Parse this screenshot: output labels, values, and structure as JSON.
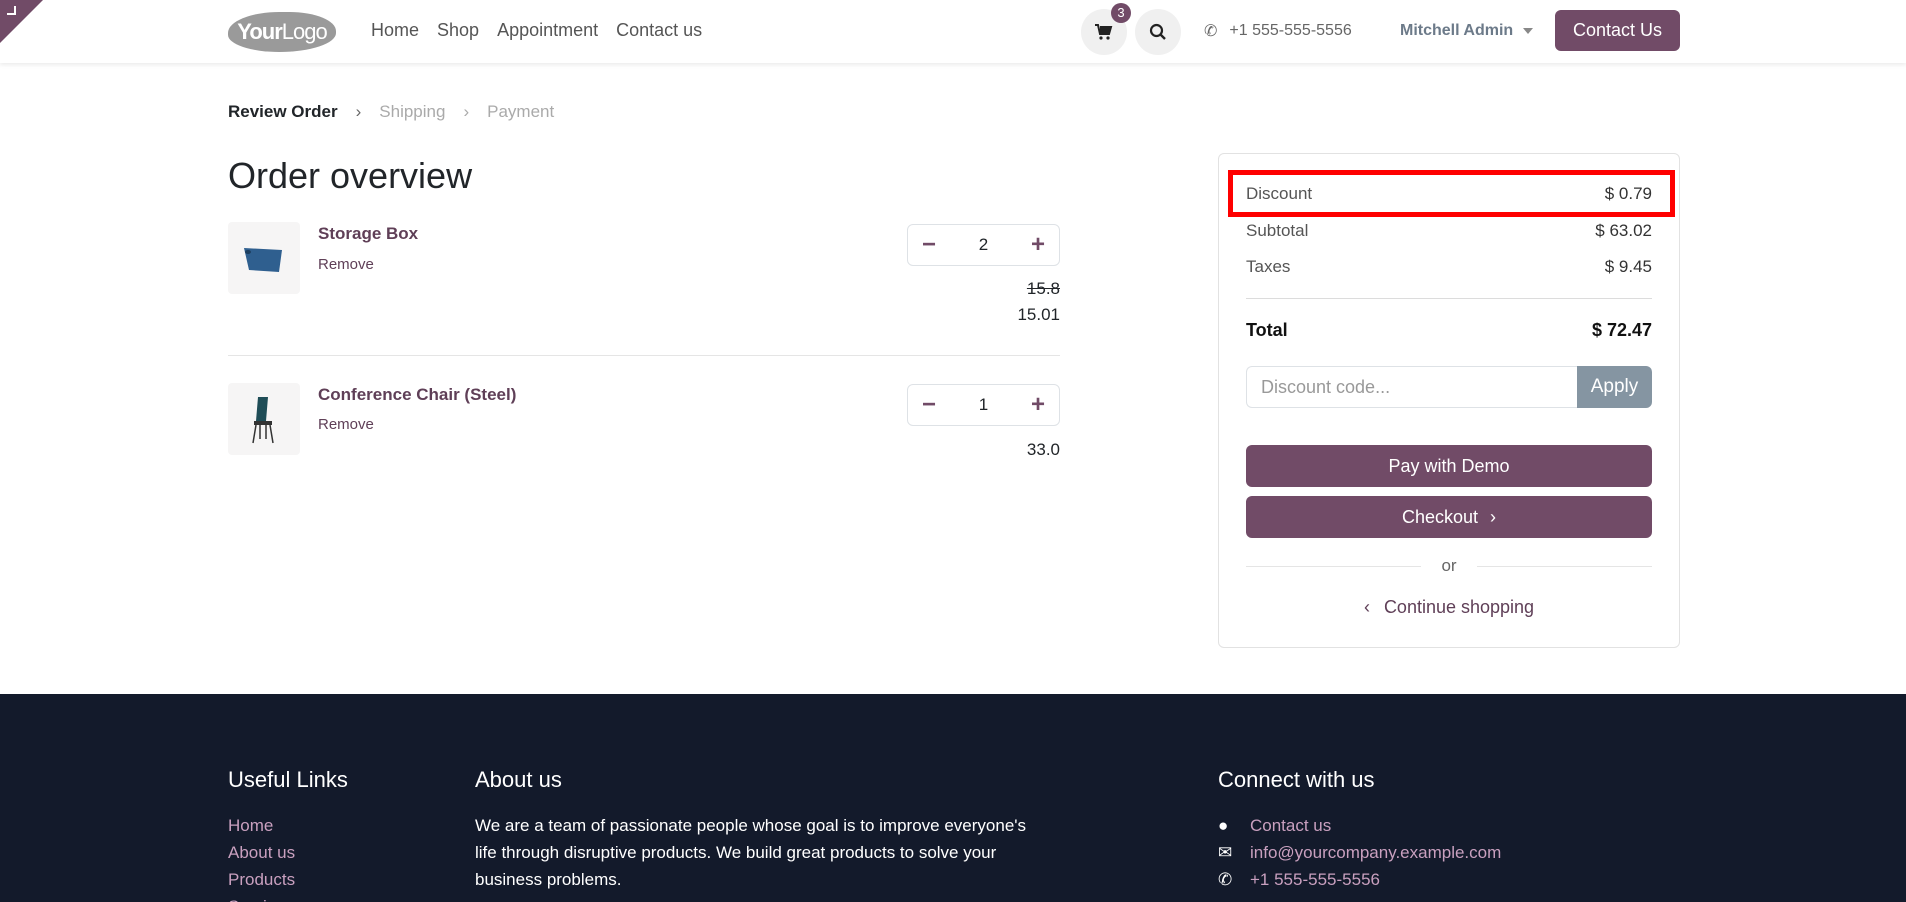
{
  "header": {
    "logo": "YourLogo",
    "logo_parts": [
      "Your",
      "Logo"
    ],
    "nav": [
      "Home",
      "Shop",
      "Appointment",
      "Contact us"
    ],
    "cart_count": "3",
    "phone": "+1 555-555-5556",
    "user": "Mitchell Admin",
    "contact_button": "Contact Us"
  },
  "breadcrumb": [
    "Review Order",
    "Shipping",
    "Payment"
  ],
  "title": "Order overview",
  "items": [
    {
      "name": "Storage Box",
      "remove": "Remove",
      "qty": "2",
      "old_price": "15.8",
      "price": "15.01"
    },
    {
      "name": "Conference Chair (Steel)",
      "remove": "Remove",
      "qty": "1",
      "price": "33.0"
    }
  ],
  "summary": {
    "discount_label": "Discount",
    "discount": "$ 0.79",
    "subtotal_label": "Subtotal",
    "subtotal": "$ 63.02",
    "taxes_label": "Taxes",
    "taxes": "$ 9.45",
    "total_label": "Total",
    "total": "$ 72.47",
    "code_placeholder": "Discount code...",
    "apply": "Apply",
    "pay": "Pay with Demo",
    "checkout": "Checkout",
    "or": "or",
    "continue": "Continue shopping"
  },
  "footer": {
    "links_title": "Useful Links",
    "links": [
      "Home",
      "About us",
      "Products",
      "Services"
    ],
    "about_title": "About us",
    "about_lines": [
      "We are a team of passionate people whose goal is to improve everyone's",
      "life through disruptive products. We build great products to solve your",
      "business problems."
    ],
    "connect_title": "Connect with us",
    "contact": "Contact us",
    "email": "info@yourcompany.example.com",
    "phone": "+1 555-555-5556"
  },
  "colors": {
    "primary": "#714b67",
    "highlight": "#ff0000",
    "footer_bg": "#131a2b",
    "apply": "#8595a2"
  }
}
